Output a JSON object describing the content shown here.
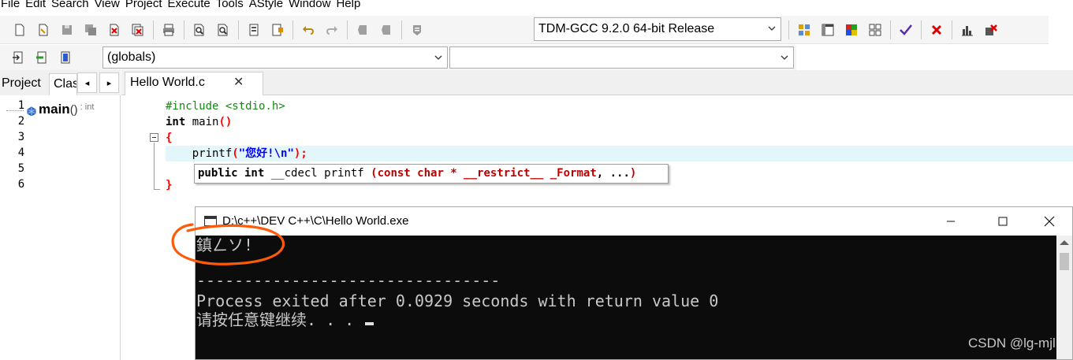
{
  "menu": [
    "File",
    "Edit",
    "Search",
    "View",
    "Project",
    "Execute",
    "Tools",
    "AStyle",
    "Window",
    "Help"
  ],
  "toolbar": {
    "compiler_selected": "TDM-GCC 9.2.0 64-bit Release",
    "icons": [
      "new-file-icon",
      "open-file-icon",
      "save-icon",
      "save-all-icon",
      "close-file-icon",
      "close-all-icon",
      "print-icon",
      "find-icon",
      "replace-icon",
      "compile-icon",
      "run-icon",
      "undo-icon",
      "redo-icon",
      "toggle-bookmark-icon",
      "goto-bookmark-icon",
      "comment-icon",
      "layout-icon",
      "window-icon",
      "color-icon",
      "grid-icon",
      "check-icon",
      "delete-icon",
      "chart-icon",
      "debug-icon"
    ]
  },
  "toolbar2": {
    "class_selected": "(globals)",
    "member_selected": ""
  },
  "left_panel": {
    "tab_project": "Project",
    "tab_classes": "Clas",
    "scroll_left": "◂",
    "scroll_right": "▸",
    "tree_item": {
      "name": "main",
      "paren": "()",
      "ret": ": int"
    }
  },
  "editor": {
    "tab_name": "Hello World.c",
    "tab_close": "✕",
    "line_numbers": [
      "1",
      "2",
      "3",
      "4",
      "5",
      "6"
    ],
    "code": {
      "l1": "#include <stdio.h>",
      "l2_kw": "int",
      "l2_rest": " main",
      "l2_paren": "()",
      "l3": "{",
      "l4_indent": "    ",
      "l4_fn": "printf",
      "l4_open": "(",
      "l4_str": "\"您好!\\n\"",
      "l4_close": ");",
      "l6": "}"
    },
    "calltip": {
      "pre": "public int",
      "mid": " __cdecl printf ",
      "open": "(",
      "args": "const char * __restrict__ _Format",
      "rest": ", ...",
      "close": ")"
    }
  },
  "console": {
    "title": "D:\\c++\\DEV C++\\C\\Hello World.exe",
    "output": {
      "line1": "鎮ㄥソ!",
      "line2": "",
      "line3": "--------------------------------",
      "line4": "Process exited after 0.0929 seconds with return value 0",
      "line5": "请按任意键继续. . . "
    }
  },
  "annotation_color": "#ff5a0a",
  "watermark": "CSDN @lg-mjl"
}
